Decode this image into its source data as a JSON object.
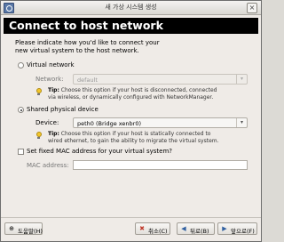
{
  "window": {
    "title": "새 가상 시스템 생성"
  },
  "header": {
    "title": "Connect to host network"
  },
  "intro": {
    "line1": "Please indicate how you'd like to connect your",
    "line2": "new virtual system to the host network."
  },
  "virtual_network": {
    "label": "Virtual network",
    "selected": false,
    "network_label": "Network:",
    "network_value": "default",
    "tip_bold": "Tip:",
    "tip_line1": " Choose this option if your host is disconnected, connected",
    "tip_line2": "via wireless, or dynamically configured with NetworkManager."
  },
  "shared_device": {
    "label": "Shared physical device",
    "selected": true,
    "device_label": "Device:",
    "device_value": "peth0 (Bridge xenbr0)",
    "tip_bold": "Tip:",
    "tip_line1": " Choose this option if your host is statically connected to",
    "tip_line2": "wired ethernet, to gain the ability to migrate the virtual system."
  },
  "mac": {
    "checkbox_label": "Set fixed MAC address for your virtual system?",
    "checked": false,
    "address_label": "MAC address:",
    "address_value": ""
  },
  "buttons": {
    "help": "도움말(H)",
    "cancel": "취소(C)",
    "back": "뒤로(B)",
    "forward": "앞으로(F)"
  },
  "icons": {
    "tip": "lightbulb-icon",
    "help": "help-icon",
    "cancel": "cancel-icon",
    "back": "back-arrow-icon",
    "forward": "forward-arrow-icon"
  }
}
